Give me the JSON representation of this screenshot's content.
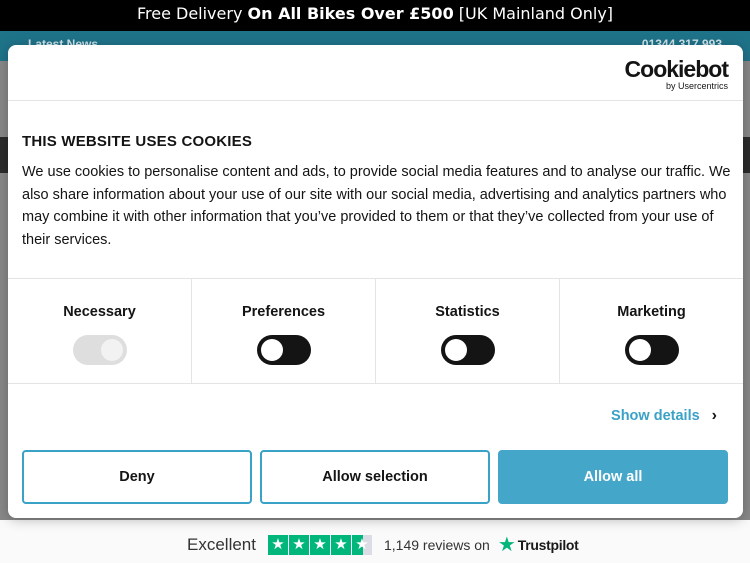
{
  "promo": {
    "prefix": "Free Delivery",
    "bold": "On All Bikes Over £500",
    "suffix": "[UK Mainland Only]"
  },
  "nav": {
    "left": "Latest News",
    "right": "01344 317 993"
  },
  "dialog": {
    "brand_name": "Cookiebot",
    "brand_sub": "by Usercentrics",
    "title": "THIS WEBSITE USES COOKIES",
    "body": "We use cookies to personalise content and ads, to provide social media features and to analyse our traffic. We also share information about your use of our site with our social media, advertising and analytics partners who may combine it with other information that you’ve provided to them or that they’ve collected from your use of their services.",
    "categories": [
      {
        "label": "Necessary",
        "enabled": true,
        "locked": true
      },
      {
        "label": "Preferences",
        "enabled": false,
        "locked": false
      },
      {
        "label": "Statistics",
        "enabled": false,
        "locked": false
      },
      {
        "label": "Marketing",
        "enabled": false,
        "locked": false
      }
    ],
    "show_details": "Show details",
    "buttons": {
      "deny": "Deny",
      "allow_selection": "Allow selection",
      "allow_all": "Allow all"
    }
  },
  "trustpilot": {
    "rating_word": "Excellent",
    "stars": 4.5,
    "reviews": "1,149 reviews on",
    "brand": "Trustpilot"
  },
  "colors": {
    "accent": "#44a6c8",
    "nav": "#1f7389",
    "trust_green": "#00b67a"
  }
}
